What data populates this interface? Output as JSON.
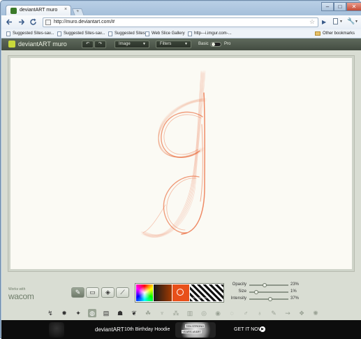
{
  "browser": {
    "tab_title": "deviantART muro",
    "tab_close": "×",
    "new_tab": "+",
    "window_controls": [
      "–",
      "□",
      "✕"
    ],
    "back_icon": "arrow-left-icon",
    "forward_icon": "arrow-right-icon",
    "reload_icon": "reload-icon",
    "url": "http://muro.deviantart.com/#",
    "star": "☆",
    "bookmarks": [
      "Suggested Sites-sav...",
      "Suggested Sites-sav...",
      "Suggested Sites",
      "Web Slice Gallery",
      "http---i.imgur.com-..."
    ],
    "other_bookmarks": "Other bookmarks"
  },
  "muro": {
    "logo_text": "deviantART muro",
    "undo_icon": "↶",
    "redo_icon": "↷",
    "image_menu": "Image",
    "filters_menu": "Filters",
    "mode_basic": "Basic",
    "mode_pro": "Pro",
    "works_with": "Works with",
    "wacom": "wacom",
    "tools": [
      "brush-icon",
      "eraser-icon",
      "fill-icon",
      "eyedropper-icon"
    ],
    "tool_glyphs": [
      "✎",
      "▭",
      "◈",
      "⟋"
    ],
    "fg_color": "#e8501a",
    "palette_bg_label": "background",
    "sliders": [
      {
        "label": "Opacity",
        "value": "23%",
        "fraction": 0.23
      },
      {
        "label": "Size",
        "value": "1%",
        "fraction": 0.01
      },
      {
        "label": "Intensity",
        "value": "37%",
        "fraction": 0.37
      }
    ],
    "brushes": [
      "↯",
      "✸",
      "✦",
      "◍",
      "▤",
      "☗",
      "❦",
      "☘",
      "♆",
      "⁂",
      "▥",
      "◎",
      "◉",
      "◌",
      "♂",
      "♁",
      "✎",
      "⇝",
      "❖",
      "✺"
    ],
    "selected_brush_index": 3,
    "stroke_color": "#e8501a"
  },
  "ad": {
    "brand": "deviantART",
    "title": "10th Birthday Hoodie",
    "badge_top": "TEN STRONG",
    "badge_bottom": "YEARS of ART",
    "cta": "GET IT NOW",
    "cta_icon": "▶"
  }
}
